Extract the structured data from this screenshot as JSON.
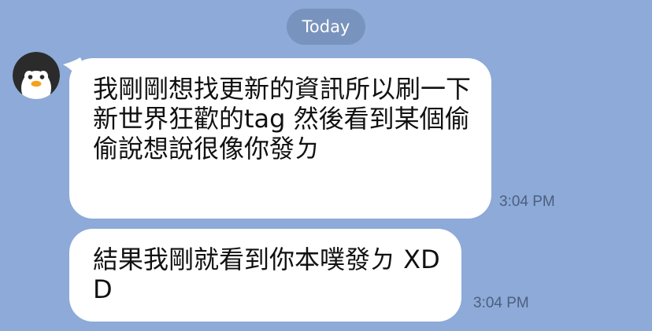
{
  "chat": {
    "date_separator": "Today",
    "messages": [
      {
        "text": "我剛剛想找更新的資訊所以刷一下新世界狂歡的tag 然後看到某個偷偷說想說很像你發ㄉ",
        "time": "3:04 PM"
      },
      {
        "text": "結果我剛就看到你本噗發ㄉ XDD",
        "time": "3:04 PM"
      }
    ],
    "avatar_icon": "penguin-icon"
  },
  "colors": {
    "background": "#8daad8",
    "date_pill": "#7893bd",
    "bubble": "#ffffff",
    "timestamp": "#4c5f7f"
  }
}
